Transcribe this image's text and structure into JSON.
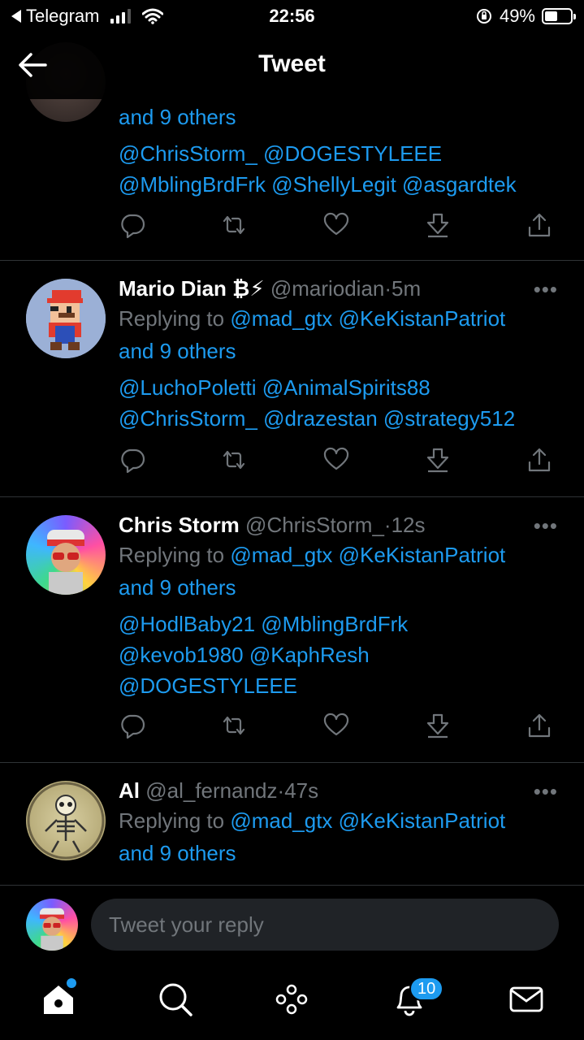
{
  "status_bar": {
    "back_app": "Telegram",
    "time": "22:56",
    "battery": "49%",
    "battery_level": 0.49
  },
  "header": {
    "title": "Tweet"
  },
  "tweets": [
    {
      "partial": true,
      "others_text": "and 9 others",
      "mentions_lines": [
        "@ChrisStorm_ @DOGESTYLEEE",
        "@MblingBrdFrk @ShellyLegit @asgardtek"
      ]
    },
    {
      "name": "Mario Dian ₿⚡",
      "handle": "@mariodian",
      "dot": "·",
      "time": "5m",
      "replying_prefix": "Replying to",
      "replying_mentions": "@mad_gtx @KeKistanPatriot",
      "others_text": "and 9 others",
      "mentions_lines": [
        "@LuchoPoletti @AnimalSpirits88",
        "@ChrisStorm_ @drazestan @strategy512"
      ]
    },
    {
      "name": "Chris Storm",
      "handle": "@ChrisStorm_",
      "dot": "·",
      "time": "12s",
      "replying_prefix": "Replying to",
      "replying_mentions": "@mad_gtx @KeKistanPatriot",
      "others_text": "and 9 others",
      "mentions_lines": [
        "@HodlBaby21 @MblingBrdFrk",
        "@kevob1980 @KaphResh",
        "@DOGESTYLEEE"
      ]
    },
    {
      "name": "Al",
      "handle": "@al_fernandz",
      "dot": "·",
      "time": "47s",
      "replying_prefix": "Replying to",
      "replying_mentions": "@mad_gtx @KeKistanPatriot",
      "others_text": "and 9 others"
    }
  ],
  "reply_bar": {
    "placeholder": "Tweet your reply"
  },
  "tab_bar": {
    "notifications_count": "10",
    "icons": [
      "home-icon",
      "search-icon",
      "spaces-icon",
      "notifications-icon",
      "messages-icon"
    ]
  },
  "colors": {
    "accent": "#1d9bf0",
    "muted": "#71767b",
    "background": "#000000",
    "divider": "#2f3336"
  }
}
